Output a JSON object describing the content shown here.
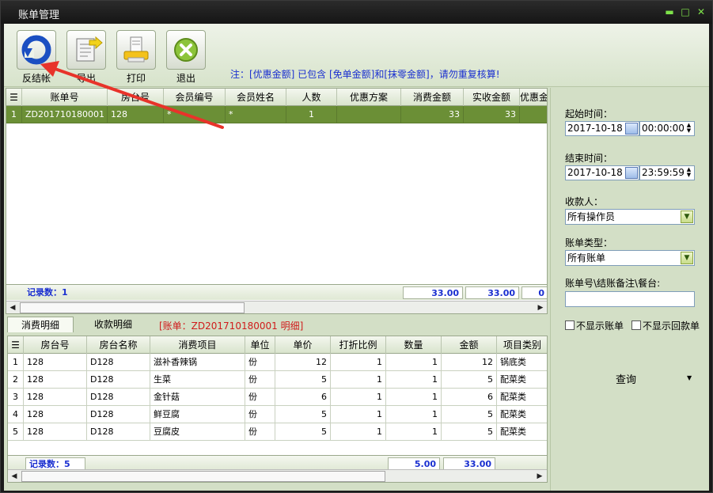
{
  "window": {
    "title": "账单管理"
  },
  "toolbar": {
    "buttons": [
      {
        "label": "反结帐",
        "icon": "undo-icon"
      },
      {
        "label": "导出",
        "icon": "export-icon"
      },
      {
        "label": "打印",
        "icon": "print-icon"
      },
      {
        "label": "退出",
        "icon": "exit-icon"
      }
    ],
    "notice": "注：[优惠金额] 已包含 [免单金额]和[抹零金额]，请勿重复核算!"
  },
  "bill_grid": {
    "columns": [
      "账单号",
      "房台号",
      "会员编号",
      "会员姓名",
      "人数",
      "优惠方案",
      "消费金额",
      "实收金额",
      "优惠金"
    ],
    "rows": [
      {
        "idx": "1",
        "bill_no": "ZD201710180001",
        "room": "128",
        "member_no": "*",
        "member_name": "*",
        "people": "1",
        "plan": "",
        "consume": "33",
        "received": "33",
        "discount": ""
      }
    ],
    "footer": {
      "record_count": "记录数：1",
      "consume_total": "33.00",
      "received_total": "33.00",
      "discount_total": "0"
    }
  },
  "tabs": {
    "items": [
      "消费明细",
      "收款明细"
    ],
    "bill_note": "[账单：ZD201710180001 明细]"
  },
  "detail_grid": {
    "columns": [
      "房台号",
      "房台名称",
      "消费项目",
      "单位",
      "单价",
      "打折比例",
      "数量",
      "金额",
      "项目类别"
    ],
    "rows": [
      {
        "idx": "1",
        "room": "128",
        "room_name": "D128",
        "item": "滋补香辣锅",
        "unit": "份",
        "price": "12",
        "discount": "1",
        "qty": "1",
        "amount": "12",
        "category": "锅底类"
      },
      {
        "idx": "2",
        "room": "128",
        "room_name": "D128",
        "item": "生菜",
        "unit": "份",
        "price": "5",
        "discount": "1",
        "qty": "1",
        "amount": "5",
        "category": "配菜类"
      },
      {
        "idx": "3",
        "room": "128",
        "room_name": "D128",
        "item": "金针菇",
        "unit": "份",
        "price": "6",
        "discount": "1",
        "qty": "1",
        "amount": "6",
        "category": "配菜类"
      },
      {
        "idx": "4",
        "room": "128",
        "room_name": "D128",
        "item": "鲜豆腐",
        "unit": "份",
        "price": "5",
        "discount": "1",
        "qty": "1",
        "amount": "5",
        "category": "配菜类"
      },
      {
        "idx": "5",
        "room": "128",
        "room_name": "D128",
        "item": "豆腐皮",
        "unit": "份",
        "price": "5",
        "discount": "1",
        "qty": "1",
        "amount": "5",
        "category": "配菜类"
      }
    ],
    "footer": {
      "record_count": "记录数：5",
      "qty_total": "5.00",
      "amount_total": "33.00"
    }
  },
  "filters": {
    "start_label": "起始时间：",
    "start_date": "2017-10-18",
    "start_time": "00:00:00",
    "end_label": "结束时间：",
    "end_date": "2017-10-18",
    "end_time": "23:59:59",
    "cashier_label": "收款人：",
    "cashier_value": "所有操作员",
    "bill_type_label": "账单类型：",
    "bill_type_value": "所有账单",
    "search_label": "账单号\\结账备注\\餐台:",
    "search_value": "",
    "hide_bill_label": "不显示账单",
    "hide_refund_label": "不显示回款单",
    "query_label": "查询"
  },
  "colors": {
    "selected_row": "#6b8f36",
    "notice_text": "#1a2fd0",
    "bill_note_text": "#d01b1b",
    "annotation_arrow": "#e8332a"
  }
}
